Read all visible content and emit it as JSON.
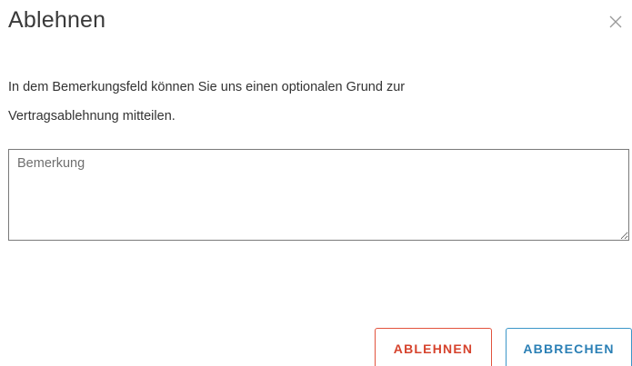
{
  "dialog": {
    "title": "Ablehnen",
    "close_icon": "close-icon",
    "message_line1": "In dem Bemerkungsfeld können Sie uns einen optionalen Grund zur",
    "message_line2": "Vertragsablehnung mitteilen.",
    "remark": {
      "placeholder": "Bemerkung",
      "value": ""
    },
    "buttons": {
      "reject_label": "ABLEHNEN",
      "cancel_label": "ABBRECHEN"
    }
  },
  "colors": {
    "reject": "#d6432d",
    "cancel": "#2a7fb5",
    "title": "#3a3a3a",
    "border": "#7a7a7a"
  }
}
